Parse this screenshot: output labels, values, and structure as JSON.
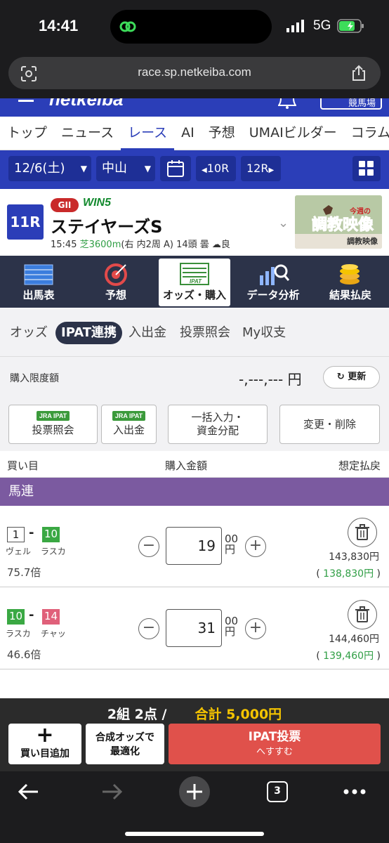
{
  "status": {
    "time": "14:41",
    "network": "5G"
  },
  "browser": {
    "url": "race.sp.netkeiba.com",
    "tab_count": "3"
  },
  "site": {
    "logo": "netkeiba",
    "mypage": "競馬場"
  },
  "main_nav": [
    "トップ",
    "ニュース",
    "レース",
    "AI",
    "予想",
    "UMAIビルダー",
    "コラム"
  ],
  "date_bar": {
    "date": "12/6(土)",
    "venue": "中山",
    "prev": "10R",
    "next": "12R"
  },
  "race": {
    "number": "11R",
    "grade": "GII",
    "win5": "WIN5",
    "name": "ステイヤーズS",
    "time": "15:45",
    "surface": "芝3600m",
    "details": "(右 内2周 A) 14頭 曇",
    "going": "良",
    "banner_top": "今週の",
    "banner_main": "調教映像",
    "banner_label": "調教映像"
  },
  "tabs": [
    "出馬表",
    "予想",
    "オッズ・購入",
    "データ分析",
    "結果払戻"
  ],
  "subtabs": [
    "オッズ",
    "IPAT連携",
    "入出金",
    "投票照会",
    "My収支"
  ],
  "limit": {
    "label": "購入限度額",
    "value": "-,---,--- 円",
    "refresh": "更新"
  },
  "actions": {
    "jra": "JRA IPAT",
    "inquiry": "投票照会",
    "deposit": "入出金",
    "bulk_line1": "一括入力・",
    "bulk_line2": "資金分配",
    "edit": "変更・削除"
  },
  "columns": {
    "selection": "買い目",
    "amount": "購入金額",
    "payout": "想定払戻"
  },
  "bet_type": "馬連",
  "bets": [
    {
      "h1": "1",
      "h1_name": "ヴェル",
      "h2": "10",
      "h2_name": "ラスカ",
      "odds": "75.7倍",
      "amount": "19",
      "unit_top": "00",
      "unit_bottom": "円",
      "payout": "143,830円",
      "profit": "138,830円"
    },
    {
      "h1": "10",
      "h1_name": "ラスカ",
      "h2": "14",
      "h2_name": "チャッ",
      "odds": "46.6倍",
      "amount": "31",
      "unit_top": "00",
      "unit_bottom": "円",
      "payout": "144,460円",
      "profit": "139,460円"
    }
  ],
  "summary": {
    "count": "2組 2点 /",
    "total": "合計 5,000円"
  },
  "bottom": {
    "add_label": "買い目追加",
    "optimize_line1": "合成オッズで",
    "optimize_line2": "最適化",
    "ipat_line1": "IPAT投票",
    "ipat_line2": "へすすむ"
  },
  "colors": {
    "brand": "#2b3eb8",
    "dark": "#2c3349",
    "bettype": "#7b5aa0",
    "ipat": "#e0514b",
    "total": "#f5c400",
    "profit": "#2f9e44"
  }
}
